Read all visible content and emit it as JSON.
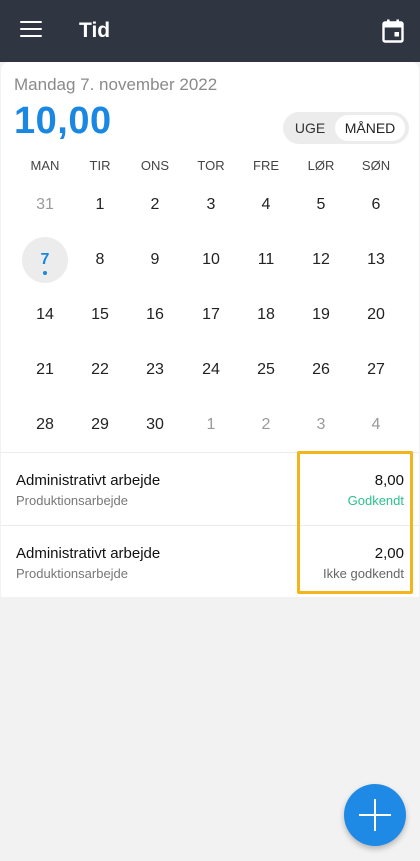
{
  "appbar": {
    "title": "Tid",
    "menu_icon": "hamburger-menu-icon",
    "calendar_icon": "calendar-icon"
  },
  "header": {
    "date": "Mandag 7. november 2022",
    "total": "10,00"
  },
  "view_toggle": {
    "options": [
      "UGE",
      "MÅNED"
    ],
    "selected": "MÅNED"
  },
  "weekdays": [
    "MAN",
    "TIR",
    "ONS",
    "TOR",
    "FRE",
    "LØR",
    "SØN"
  ],
  "calendar": {
    "weeks": [
      [
        "31",
        "1",
        "2",
        "3",
        "4",
        "5",
        "6"
      ],
      [
        "7",
        "8",
        "9",
        "10",
        "11",
        "12",
        "13"
      ],
      [
        "14",
        "15",
        "16",
        "17",
        "18",
        "19",
        "20"
      ],
      [
        "21",
        "22",
        "23",
        "24",
        "25",
        "26",
        "27"
      ],
      [
        "28",
        "29",
        "30",
        "1",
        "2",
        "3",
        "4"
      ]
    ],
    "selected_day": "7"
  },
  "entries": [
    {
      "title": "Administrativt arbejde",
      "subtitle": "Produktionsarbejde",
      "hours": "8,00",
      "status": "Godkendt"
    },
    {
      "title": "Administrativt arbejde",
      "subtitle": "Produktionsarbejde",
      "hours": "2,00",
      "status": "Ikke godkendt"
    }
  ],
  "colors": {
    "appbar": "#2f3641",
    "accent": "#1a87e3",
    "approved": "#2dbf8f",
    "highlight": "#f3b51b",
    "fab": "#1f8ae6"
  },
  "fab": {
    "icon": "plus-icon"
  }
}
